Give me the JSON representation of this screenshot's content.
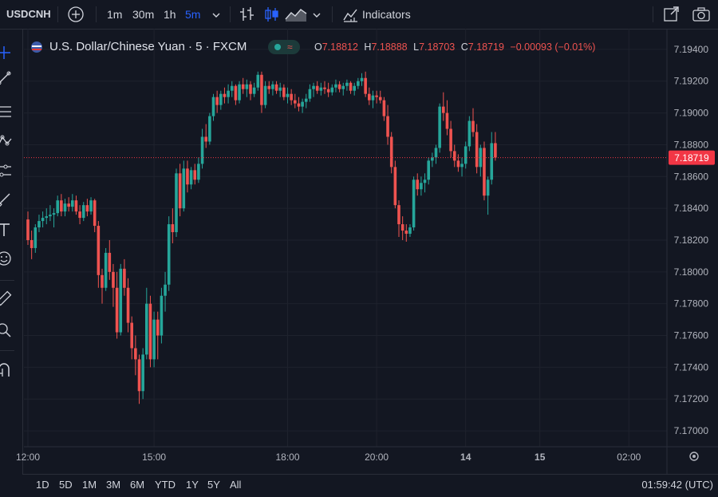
{
  "toolbar": {
    "symbol": "USDCNH",
    "intervals": [
      "1m",
      "30m",
      "1h",
      "5m"
    ],
    "active_interval": "5m",
    "indicators_label": "Indicators"
  },
  "legend": {
    "title": "U.S. Dollar/Chinese Yuan · 5 · FXCM",
    "o_label": "O",
    "o_value": "7.18812",
    "h_label": "H",
    "h_value": "7.18888",
    "l_label": "L",
    "l_value": "7.18703",
    "c_label": "C",
    "c_value": "7.18719",
    "change": "−0.00093 (−0.01%)"
  },
  "range_buttons": [
    "1D",
    "5D",
    "1M",
    "3M",
    "6M",
    "YTD",
    "1Y",
    "5Y",
    "All"
  ],
  "clock": "01:59:42 (UTC)",
  "colors": {
    "up": "#26a69a",
    "down": "#ef5350",
    "background": "#131722",
    "grid": "#1e222d",
    "last_price": "#f23645"
  },
  "chart_data": {
    "type": "candlestick",
    "symbol": "USDCNH",
    "interval": "5",
    "ylim": [
      7.169,
      7.1953
    ],
    "y_ticks": [
      7.17,
      7.172,
      7.174,
      7.176,
      7.178,
      7.18,
      7.182,
      7.184,
      7.186,
      7.188,
      7.19,
      7.192,
      7.194
    ],
    "x_ticks": [
      {
        "label": "12:00",
        "index": 0
      },
      {
        "label": "15:00",
        "index": 34
      },
      {
        "label": "18:00",
        "index": 70
      },
      {
        "label": "20:00",
        "index": 94
      },
      {
        "label": "14",
        "index": 118,
        "bold": true
      },
      {
        "label": "15",
        "index": 138,
        "bold": true
      },
      {
        "label": "02:00",
        "index": 162
      }
    ],
    "last_price": 7.18719,
    "last_price_label": "7.18719",
    "candles": [
      [
        7.1833,
        7.1838,
        7.1817,
        7.182
      ],
      [
        7.182,
        7.1826,
        7.1808,
        7.1815
      ],
      [
        7.1815,
        7.183,
        7.1812,
        7.1828
      ],
      [
        7.1828,
        7.1836,
        7.1825,
        7.1832
      ],
      [
        7.1832,
        7.1838,
        7.1828,
        7.1834
      ],
      [
        7.1834,
        7.184,
        7.183,
        7.1835
      ],
      [
        7.1835,
        7.1842,
        7.1832,
        7.1836
      ],
      [
        7.1836,
        7.184,
        7.1828,
        7.1837
      ],
      [
        7.1837,
        7.1848,
        7.1835,
        7.1845
      ],
      [
        7.1845,
        7.1849,
        7.1835,
        7.1838
      ],
      [
        7.1838,
        7.1846,
        7.1835,
        7.1843
      ],
      [
        7.1843,
        7.1847,
        7.1838,
        7.1841
      ],
      [
        7.1841,
        7.1849,
        7.1838,
        7.1845
      ],
      [
        7.1845,
        7.1848,
        7.1836,
        7.1838
      ],
      [
        7.1838,
        7.1842,
        7.183,
        7.1834
      ],
      [
        7.1834,
        7.1844,
        7.1832,
        7.1842
      ],
      [
        7.1842,
        7.1846,
        7.1835,
        7.1838
      ],
      [
        7.1838,
        7.1847,
        7.1836,
        7.1845
      ],
      [
        7.1845,
        7.1846,
        7.1825,
        7.1829
      ],
      [
        7.1829,
        7.1832,
        7.179,
        7.1798
      ],
      [
        7.1798,
        7.1802,
        7.178,
        7.179
      ],
      [
        7.179,
        7.1815,
        7.1788,
        7.1812
      ],
      [
        7.1812,
        7.182,
        7.1795,
        7.18
      ],
      [
        7.18,
        7.1805,
        7.1778,
        7.179
      ],
      [
        7.179,
        7.18,
        7.1758,
        7.1762
      ],
      [
        7.1762,
        7.1805,
        7.176,
        7.1802
      ],
      [
        7.1802,
        7.1808,
        7.1785,
        7.179
      ],
      [
        7.179,
        7.1796,
        7.1762,
        7.1768
      ],
      [
        7.1768,
        7.1772,
        7.1745,
        7.1752
      ],
      [
        7.1752,
        7.176,
        7.1735,
        7.1745
      ],
      [
        7.1745,
        7.1748,
        7.1717,
        7.1725
      ],
      [
        7.1725,
        7.1752,
        7.172,
        7.1748
      ],
      [
        7.1748,
        7.179,
        7.1745,
        7.178
      ],
      [
        7.178,
        7.1785,
        7.174,
        7.1745
      ],
      [
        7.1745,
        7.1775,
        7.174,
        7.177
      ],
      [
        7.177,
        7.1775,
        7.1745,
        7.176
      ],
      [
        7.176,
        7.179,
        7.1755,
        7.1785
      ],
      [
        7.1785,
        7.18,
        7.1775,
        7.1792
      ],
      [
        7.1792,
        7.1835,
        7.1788,
        7.183
      ],
      [
        7.183,
        7.184,
        7.1818,
        7.1825
      ],
      [
        7.1825,
        7.1865,
        7.1822,
        7.1862
      ],
      [
        7.1862,
        7.1868,
        7.1835,
        7.184
      ],
      [
        7.184,
        7.187,
        7.1838,
        7.1865
      ],
      [
        7.1865,
        7.187,
        7.185,
        7.1855
      ],
      [
        7.1855,
        7.1866,
        7.1852,
        7.1864
      ],
      [
        7.1864,
        7.1868,
        7.1855,
        7.1858
      ],
      [
        7.1858,
        7.1872,
        7.1856,
        7.1868
      ],
      [
        7.1868,
        7.189,
        7.1865,
        7.1885
      ],
      [
        7.1885,
        7.1893,
        7.1878,
        7.1882
      ],
      [
        7.1882,
        7.19,
        7.188,
        7.1898
      ],
      [
        7.1898,
        7.1912,
        7.1895,
        7.191
      ],
      [
        7.191,
        7.1914,
        7.19,
        7.1905
      ],
      [
        7.1905,
        7.1914,
        7.1902,
        7.1912
      ],
      [
        7.1912,
        7.1916,
        7.1906,
        7.191
      ],
      [
        7.191,
        7.1918,
        7.1906,
        7.1914
      ],
      [
        7.1914,
        7.192,
        7.191,
        7.1917
      ],
      [
        7.1917,
        7.1918,
        7.1905,
        7.1908
      ],
      [
        7.1908,
        7.192,
        7.1906,
        7.1918
      ],
      [
        7.1918,
        7.1922,
        7.1912,
        7.1915
      ],
      [
        7.1915,
        7.1921,
        7.191,
        7.1918
      ],
      [
        7.1918,
        7.192,
        7.1908,
        7.1912
      ],
      [
        7.1912,
        7.1919,
        7.191,
        7.1916
      ],
      [
        7.1916,
        7.1926,
        7.1914,
        7.1924
      ],
      [
        7.1924,
        7.1926,
        7.19,
        7.1905
      ],
      [
        7.1905,
        7.192,
        7.1903,
        7.1917
      ],
      [
        7.1917,
        7.192,
        7.1912,
        7.1915
      ],
      [
        7.1915,
        7.192,
        7.1911,
        7.1918
      ],
      [
        7.1918,
        7.192,
        7.1912,
        7.1914
      ],
      [
        7.1914,
        7.1919,
        7.191,
        7.1916
      ],
      [
        7.1916,
        7.1918,
        7.1908,
        7.191
      ],
      [
        7.191,
        7.1916,
        7.1906,
        7.1912
      ],
      [
        7.1912,
        7.1915,
        7.1905,
        7.1908
      ],
      [
        7.1908,
        7.1912,
        7.1903,
        7.1906
      ],
      [
        7.1906,
        7.191,
        7.1901,
        7.1904
      ],
      [
        7.1904,
        7.1909,
        7.19,
        7.1907
      ],
      [
        7.1907,
        7.1912,
        7.1903,
        7.1909
      ],
      [
        7.1909,
        7.1918,
        7.1907,
        7.1915
      ],
      [
        7.1915,
        7.1919,
        7.191,
        7.1917
      ],
      [
        7.1917,
        7.192,
        7.1912,
        7.1914
      ],
      [
        7.1914,
        7.1919,
        7.1911,
        7.1916
      ],
      [
        7.1916,
        7.192,
        7.1912,
        7.1915
      ],
      [
        7.1915,
        7.1919,
        7.191,
        7.1913
      ],
      [
        7.1913,
        7.1918,
        7.1911,
        7.1916
      ],
      [
        7.1916,
        7.1921,
        7.1913,
        7.1918
      ],
      [
        7.1918,
        7.192,
        7.1913,
        7.1915
      ],
      [
        7.1915,
        7.1919,
        7.1911,
        7.1917
      ],
      [
        7.1917,
        7.1921,
        7.1914,
        7.1919
      ],
      [
        7.1919,
        7.192,
        7.1912,
        7.1914
      ],
      [
        7.1914,
        7.1919,
        7.1911,
        7.1917
      ],
      [
        7.1917,
        7.1922,
        7.1915,
        7.192
      ],
      [
        7.192,
        7.1925,
        7.1917,
        7.1922
      ],
      [
        7.1922,
        7.1926,
        7.191,
        7.1912
      ],
      [
        7.1912,
        7.1916,
        7.1905,
        7.1908
      ],
      [
        7.1908,
        7.1914,
        7.1903,
        7.1911
      ],
      [
        7.1911,
        7.1914,
        7.1906,
        7.191
      ],
      [
        7.191,
        7.1914,
        7.1906,
        7.1908
      ],
      [
        7.1908,
        7.191,
        7.1895,
        7.1898
      ],
      [
        7.1898,
        7.1905,
        7.188,
        7.1885
      ],
      [
        7.1885,
        7.1888,
        7.1862,
        7.1866
      ],
      [
        7.1866,
        7.187,
        7.184,
        7.1842
      ],
      [
        7.1842,
        7.1845,
        7.1822,
        7.183
      ],
      [
        7.183,
        7.1835,
        7.182,
        7.1826
      ],
      [
        7.1826,
        7.183,
        7.1819,
        7.1824
      ],
      [
        7.1824,
        7.183,
        7.1822,
        7.1828
      ],
      [
        7.1828,
        7.186,
        7.1826,
        7.1858
      ],
      [
        7.1858,
        7.1862,
        7.1848,
        7.1852
      ],
      [
        7.1852,
        7.186,
        7.1848,
        7.1856
      ],
      [
        7.1856,
        7.1862,
        7.185,
        7.1858
      ],
      [
        7.1858,
        7.1872,
        7.1855,
        7.187
      ],
      [
        7.187,
        7.1875,
        7.1866,
        7.1872
      ],
      [
        7.1872,
        7.188,
        7.1868,
        7.1878
      ],
      [
        7.1878,
        7.1906,
        7.1875,
        7.1904
      ],
      [
        7.1904,
        7.1913,
        7.1895,
        7.19
      ],
      [
        7.19,
        7.1908,
        7.1886,
        7.189
      ],
      [
        7.189,
        7.1895,
        7.1872,
        7.1876
      ],
      [
        7.1876,
        7.188,
        7.1866,
        7.187
      ],
      [
        7.187,
        7.1874,
        7.1863,
        7.1866
      ],
      [
        7.1866,
        7.1872,
        7.186,
        7.1868
      ],
      [
        7.1868,
        7.1882,
        7.1865,
        7.1879
      ],
      [
        7.1879,
        7.1898,
        7.1876,
        7.1895
      ],
      [
        7.1895,
        7.1903,
        7.1885,
        7.1888
      ],
      [
        7.1888,
        7.1893,
        7.1862,
        7.1866
      ],
      [
        7.1866,
        7.188,
        7.186,
        7.1878
      ],
      [
        7.1878,
        7.1882,
        7.1845,
        7.1848
      ],
      [
        7.1848,
        7.186,
        7.1836,
        7.1858
      ],
      [
        7.1858,
        7.1888,
        7.1855,
        7.1881
      ],
      [
        7.1881,
        7.1888,
        7.187,
        7.1872
      ]
    ]
  }
}
